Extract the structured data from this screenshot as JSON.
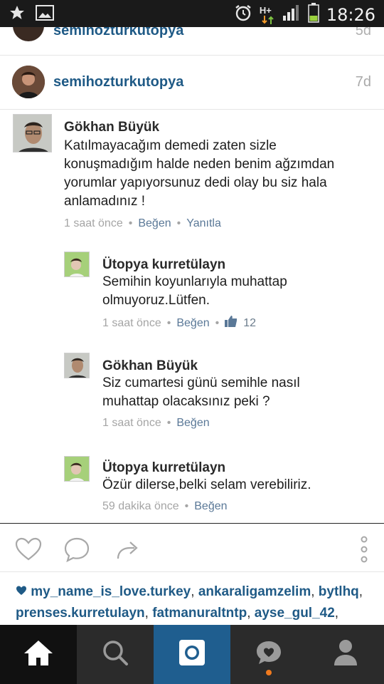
{
  "status_bar": {
    "time": "18:26",
    "network_label": "H+"
  },
  "previous_post": {
    "username": "semihozturkutopya",
    "ago": "5d"
  },
  "post": {
    "username": "semihozturkutopya",
    "ago": "7d"
  },
  "comments": [
    {
      "name": "Gökhan Büyük",
      "text": "Katılmayacağım demedi zaten sizle konuşmadığım halde neden benim ağzımdan yorumlar yapıyorsunuz dedi olay bu siz hala anlamadınız !",
      "time": "1 saat önce",
      "like": "Beğen",
      "reply": "Yanıtla"
    },
    {
      "name": "Ütopya kurretülayn",
      "text": "Semihin koyunlarıyla muhattap olmuyoruz.Lütfen.",
      "time": "1 saat önce",
      "like": "Beğen",
      "likes_count": "12"
    },
    {
      "name": "Gökhan Büyük",
      "text": "Siz cumartesi günü semihle nasıl muhattap olacaksınız peki ?",
      "time": "1 saat önce",
      "like": "Beğen"
    },
    {
      "name": "Ütopya kurretülayn",
      "text": "Özür dilerse,belki selam verebiliriz.",
      "time": "59 dakika önce",
      "like": "Beğen"
    }
  ],
  "likers": [
    "my_name_is_love.turkey",
    "ankaraligamzelim",
    "bytlhq",
    "prenses.kurretulayn",
    "fatmanuraltntp",
    "ayse_gul_42"
  ],
  "colors": {
    "accent": "#1f5a86",
    "nav_bg": "#2b2b2b",
    "camera_tab": "#1f5e8f",
    "activity_dot": "#f07a1e"
  }
}
